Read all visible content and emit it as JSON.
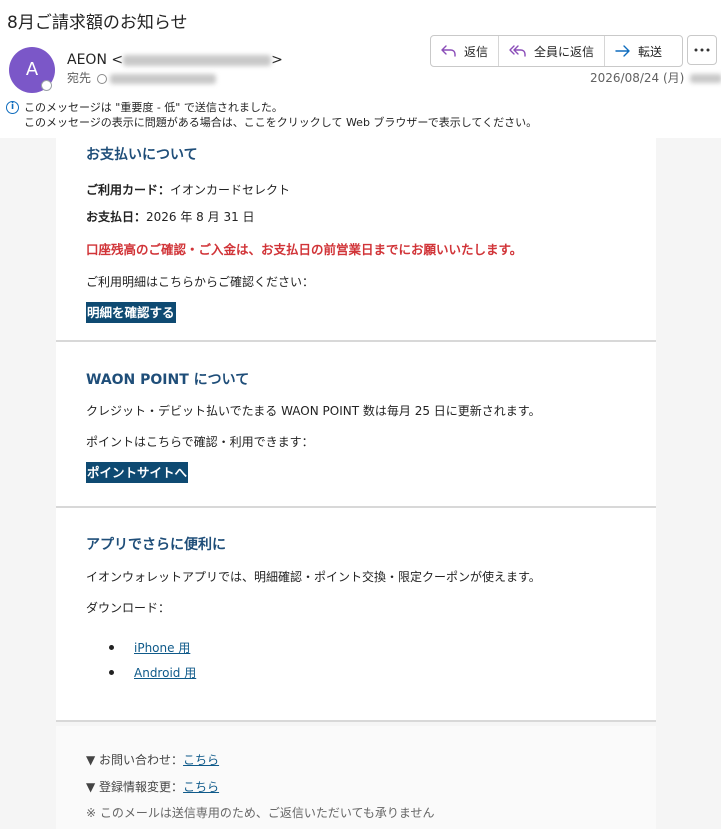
{
  "email": {
    "subject": "8月ご請求額のお知らせ",
    "avatar_letter": "A",
    "sender_name": "AEON",
    "to_label": "宛先",
    "date": "2026/08/24 (月)",
    "actions": {
      "reply": "返信",
      "reply_all": "全員に返信",
      "forward": "転送"
    },
    "info_line1": "このメッセージは \"重要度 - 低\" で送信されました。",
    "info_line2": "このメッセージの表示に問題がある場合は、ここをクリックして Web ブラウザーで表示してください。"
  },
  "payment": {
    "title": "お支払いについて",
    "card_label": "ご利用カード：",
    "card_value": "イオンカードセレクト",
    "date_label": "お支払日：",
    "date_value": "2026 年 8 月 31 日",
    "warning": "口座残高のご確認・ご入金は、お支払日の前営業日までにお願いいたします。",
    "detail_text": "ご利用明細はこちらからご確認ください：",
    "detail_button": "明細を確認する"
  },
  "waon": {
    "title": "WAON POINT について",
    "text1": "クレジット・デビット払いでたまる WAON POINT 数は毎月 25 日に更新されます。",
    "text2": "ポイントはこちらで確認・利用できます：",
    "button": "ポイントサイトへ"
  },
  "app": {
    "title": "アプリでさらに便利に",
    "text": "イオンウォレットアプリでは、明細確認・ポイント交換・限定クーポンが使えます。",
    "download_label": "ダウンロード：",
    "links": [
      "iPhone 用",
      "Android 用"
    ]
  },
  "footer": {
    "inquiry_label": "▼ お問い合わせ：",
    "inquiry_link": "こちら",
    "register_label": "▼ 登録情報変更：",
    "register_link": "こちら",
    "note": "※ このメールは送信専用のため、ご返信いただいても承りません"
  },
  "colors": {
    "accent_title": "#1f4e79",
    "button_bg": "#0e4a72",
    "warning": "#d13438",
    "avatar": "#7b57c8",
    "link": "#0f5a8a"
  },
  "icons": [
    "reply-icon",
    "reply-all-icon",
    "forward-icon",
    "more-icon",
    "info-icon"
  ]
}
